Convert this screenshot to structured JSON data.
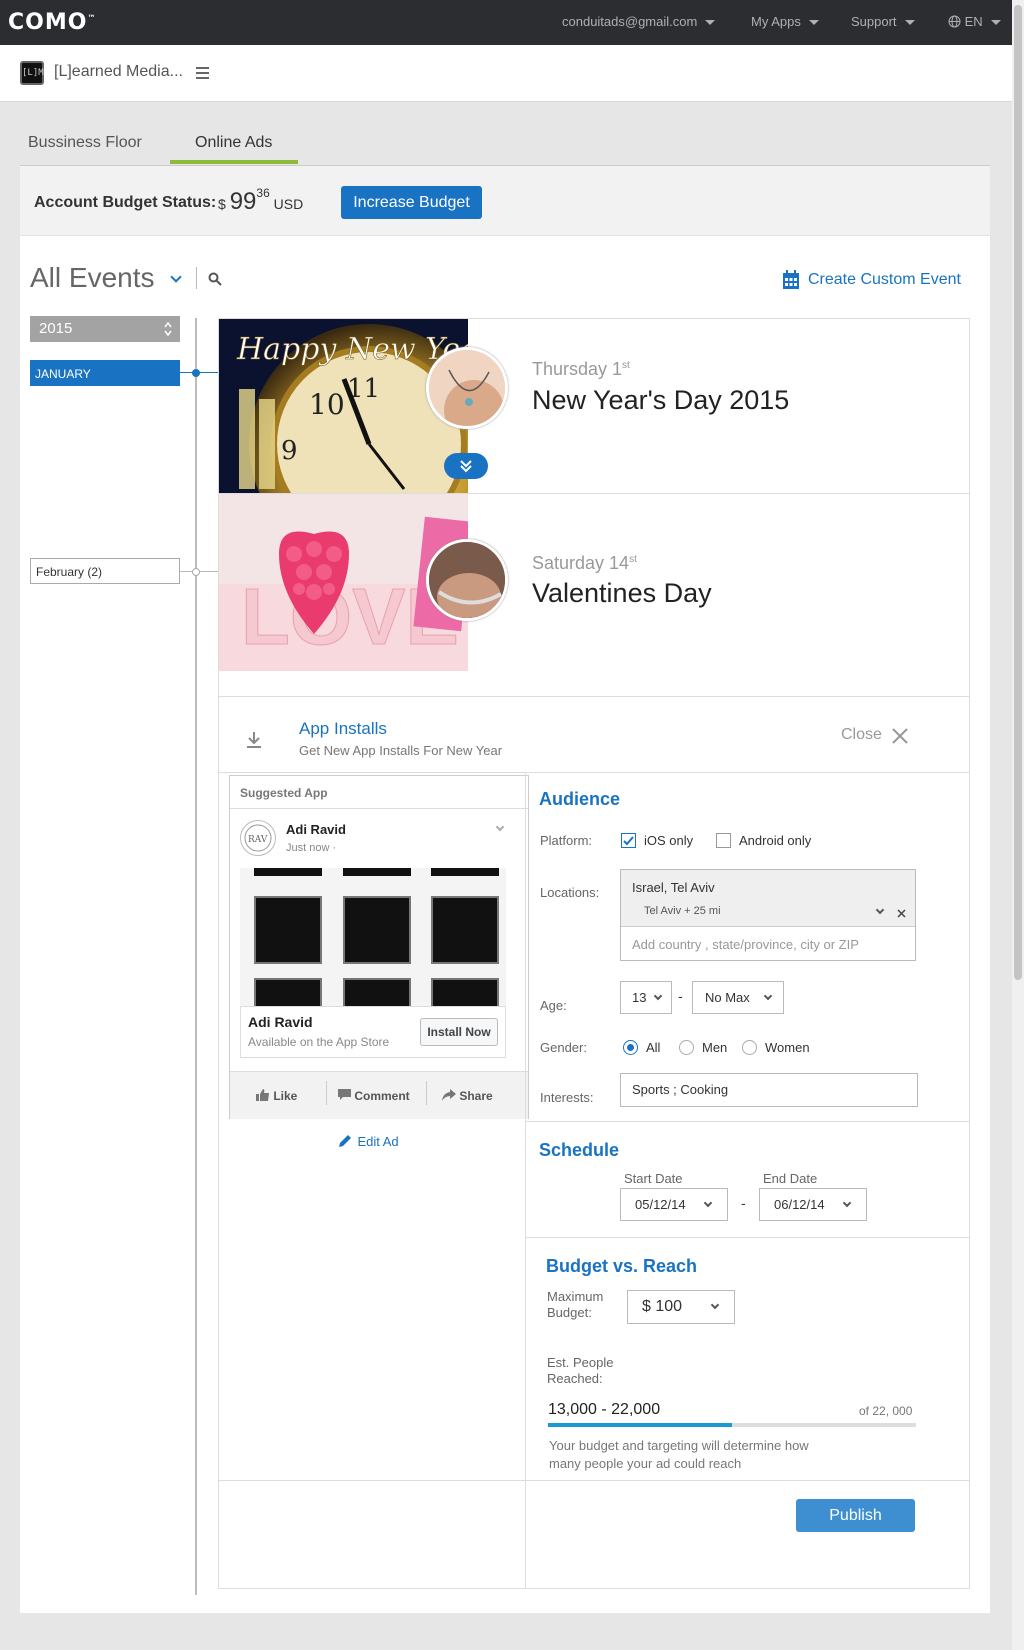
{
  "topbar": {
    "logo": "COMO",
    "logo_mark": "™",
    "account_email": "conduitads@gmail.com",
    "my_apps": "My Apps",
    "support": "Support",
    "language": "EN"
  },
  "appbar": {
    "icon_text": "[L]M",
    "app_name": "[L]earned Media..."
  },
  "tabs": [
    {
      "label": "Bussiness Floor"
    },
    {
      "label": "Online Ads"
    }
  ],
  "budget": {
    "label": "Account Budget Status:",
    "currency_symbol": "$",
    "amount_int": "99",
    "amount_cents": "36",
    "currency": "USD",
    "button": "Increase Budget"
  },
  "events_header": {
    "title": "All Events",
    "create_label": "Create Custom Event"
  },
  "calendar": {
    "year": "2015",
    "months": [
      "JANUARY",
      "February (2)"
    ]
  },
  "events": [
    {
      "day": "Thursday 1",
      "day_suffix": "st",
      "name": "New Year's Day 2015",
      "image_text": "Happy New Year"
    },
    {
      "day": "Saturday 14",
      "day_suffix": "st",
      "name": "Valentines Day",
      "image_text": "LOVE"
    }
  ],
  "detail": {
    "title": "App Installs",
    "subtitle": "Get New App Installs For New Year",
    "close": "Close"
  },
  "preview": {
    "header": "Suggested App",
    "page_name": "Adi Ravid",
    "time": "Just now ·",
    "app_name": "Adi Ravid",
    "store": "Available on the App Store",
    "install": "Install Now",
    "like": "Like",
    "comment": "Comment",
    "share": "Share",
    "edit": "Edit Ad"
  },
  "audience": {
    "heading": "Audience",
    "platform_label": "Platform:",
    "ios_label": "iOS only",
    "ios_checked": true,
    "android_label": "Android only",
    "android_checked": false,
    "locations_label": "Locations:",
    "location_value": "Israel, Tel Aviv",
    "location_radius": "Tel Aviv + 25 mi",
    "location_placeholder": "Add country , state/province, city or ZIP",
    "age_label": "Age:",
    "age_min": "13",
    "age_sep": "-",
    "age_max": "No Max",
    "gender_label": "Gender:",
    "gender_options": [
      "All",
      "Men",
      "Women"
    ],
    "gender_selected": "All",
    "interests_label": "Interests:",
    "interests_value": "Sports ; Cooking"
  },
  "schedule": {
    "heading": "Schedule",
    "start_label": "Start Date",
    "end_label": "End Date",
    "start_value": "05/12/14",
    "sep": "-",
    "end_value": "06/12/14"
  },
  "budget_reach": {
    "heading": "Budget vs. Reach",
    "max_label": "Maximum Budget:",
    "max_value": "$ 100",
    "est_label": "Est. People Reached:",
    "range": "13,000 - 22,000",
    "of_total": "of 22, 000",
    "reach_fraction": 0.5,
    "note": "Your budget and targeting will determine how many people your ad could reach"
  },
  "publish": "Publish",
  "colors": {
    "accent": "#1a73c2",
    "tab_underline": "#8dbb3c",
    "topbar": "#2b2d31"
  },
  "icons": [
    "search-icon",
    "calendar-icon",
    "download-icon",
    "close-icon",
    "pencil-icon",
    "globe-icon",
    "hamburger-icon"
  ]
}
